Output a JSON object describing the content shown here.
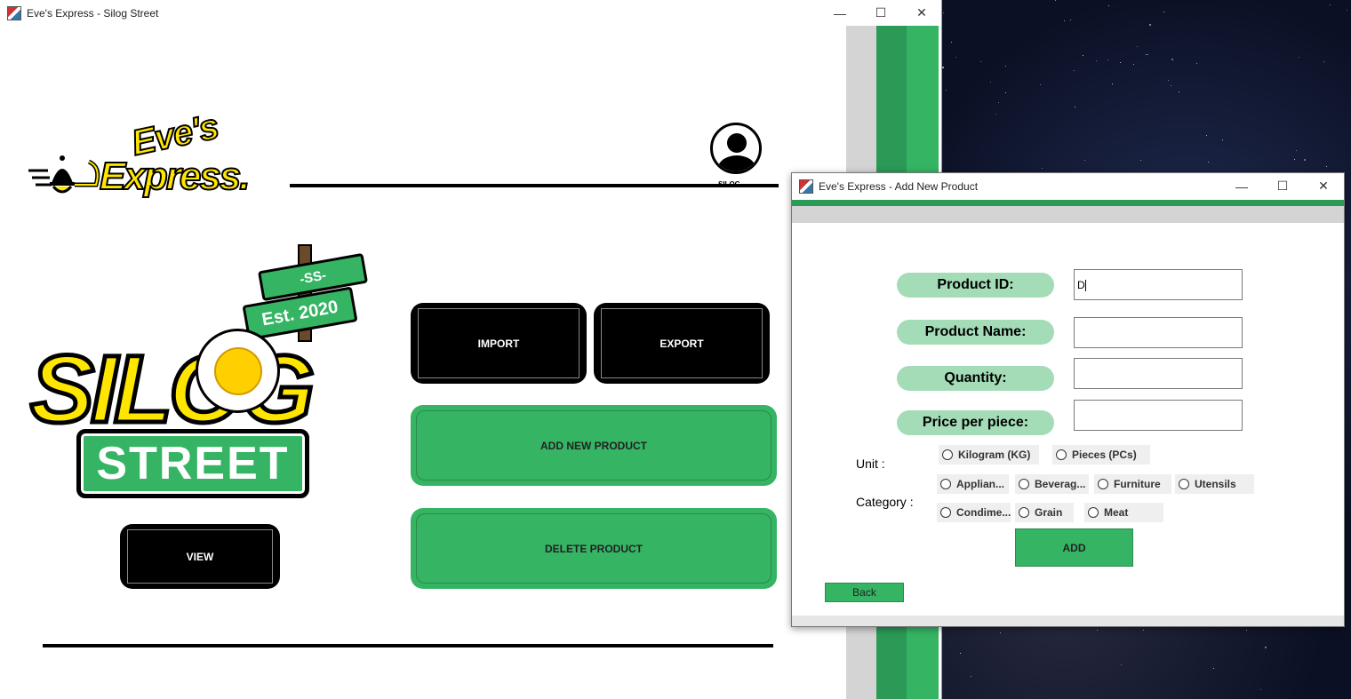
{
  "main_window": {
    "title": "Eve's Express - Silog Street",
    "controls": {
      "minimize": "—",
      "maximize": "☐",
      "close": "✕"
    },
    "eves_logo": {
      "line1": "Eve's",
      "line2": "Express."
    },
    "user_label": "SILOG",
    "silog_logo": {
      "ss": "-SS-",
      "est": "Est. 2020",
      "word": "SILOG",
      "street": "STREET"
    },
    "buttons": {
      "import": "IMPORT",
      "export": "EXPORT",
      "add_new_product": "ADD NEW PRODUCT",
      "delete_product": "DELETE PRODUCT",
      "view": "VIEW"
    }
  },
  "dialog": {
    "title": "Eve's Express - Add New Product",
    "controls": {
      "minimize": "—",
      "maximize": "☐",
      "close": "✕"
    },
    "labels": {
      "product_id": "Product ID:",
      "product_name": "Product Name:",
      "quantity": "Quantity:",
      "price": "Price per piece:",
      "unit": "Unit :",
      "category": "Category :"
    },
    "fields": {
      "product_id": "D",
      "product_name": "",
      "quantity": "",
      "price": ""
    },
    "unit_options": [
      "Kilogram (KG)",
      "Pieces (PCs)"
    ],
    "category_options": [
      "Applian...",
      "Beverag...",
      "Furniture",
      "Utensils",
      "Condime...",
      "Grain",
      "Meat"
    ],
    "add_button": "ADD",
    "back_button": "Back"
  },
  "colors": {
    "green": "#35b463",
    "dark_green": "#2a9a56",
    "pill_green": "#a3dcb7",
    "logo_yellow": "#ffe600"
  }
}
